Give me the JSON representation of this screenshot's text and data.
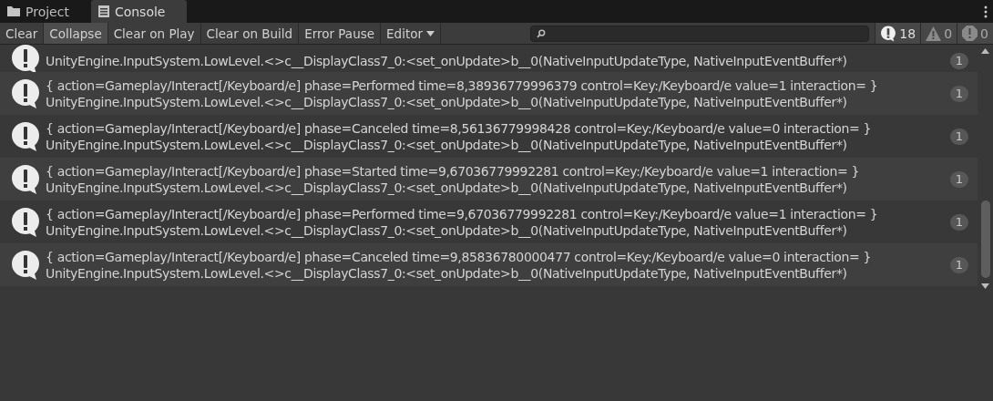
{
  "tabs": [
    {
      "label": "Project",
      "selected": false
    },
    {
      "label": "Console",
      "selected": true
    }
  ],
  "toolbar": {
    "buttons": [
      {
        "label": "Clear",
        "kind": "button",
        "selected": false
      },
      {
        "label": "Collapse",
        "kind": "toggle",
        "selected": true
      },
      {
        "label": "Clear on Play",
        "kind": "toggle",
        "selected": false
      },
      {
        "label": "Clear on Build",
        "kind": "toggle",
        "selected": false
      },
      {
        "label": "Error Pause",
        "kind": "toggle",
        "selected": false
      },
      {
        "label": "Editor",
        "kind": "dropdown",
        "selected": false
      }
    ],
    "counters": [
      {
        "kind": "info",
        "count": "18"
      },
      {
        "kind": "warning",
        "count": "0"
      },
      {
        "kind": "error",
        "count": "0"
      }
    ]
  },
  "entries": [
    {
      "partial": true,
      "trace": "UnityEngine.InputSystem.LowLevel.<>c__DisplayClass7_0:<set_onUpdate>b__0(NativeInputUpdateType, NativeInputEventBuffer*)",
      "count": "1"
    },
    {
      "partial": false,
      "message": "{ action=Gameplay/Interact[/Keyboard/e] phase=Performed time=8,38936779996379 control=Key:/Keyboard/e value=1 interaction= }",
      "trace": "UnityEngine.InputSystem.LowLevel.<>c__DisplayClass7_0:<set_onUpdate>b__0(NativeInputUpdateType, NativeInputEventBuffer*)",
      "count": "1"
    },
    {
      "partial": false,
      "message": "{ action=Gameplay/Interact[/Keyboard/e] phase=Canceled time=8,56136779998428 control=Key:/Keyboard/e value=0 interaction= }",
      "trace": "UnityEngine.InputSystem.LowLevel.<>c__DisplayClass7_0:<set_onUpdate>b__0(NativeInputUpdateType, NativeInputEventBuffer*)",
      "count": "1"
    },
    {
      "partial": false,
      "message": "{ action=Gameplay/Interact[/Keyboard/e] phase=Started time=9,67036779992281 control=Key:/Keyboard/e value=1 interaction= }",
      "trace": "UnityEngine.InputSystem.LowLevel.<>c__DisplayClass7_0:<set_onUpdate>b__0(NativeInputUpdateType, NativeInputEventBuffer*)",
      "count": "1"
    },
    {
      "partial": false,
      "message": "{ action=Gameplay/Interact[/Keyboard/e] phase=Performed time=9,67036779992281 control=Key:/Keyboard/e value=1 interaction= }",
      "trace": "UnityEngine.InputSystem.LowLevel.<>c__DisplayClass7_0:<set_onUpdate>b__0(NativeInputUpdateType, NativeInputEventBuffer*)",
      "count": "1"
    },
    {
      "partial": false,
      "message": "{ action=Gameplay/Interact[/Keyboard/e] phase=Canceled time=9,85836780000477 control=Key:/Keyboard/e value=0 interaction= }",
      "trace": "UnityEngine.InputSystem.LowLevel.<>c__DisplayClass7_0:<set_onUpdate>b__0(NativeInputUpdateType, NativeInputEventBuffer*)",
      "count": "1"
    }
  ]
}
